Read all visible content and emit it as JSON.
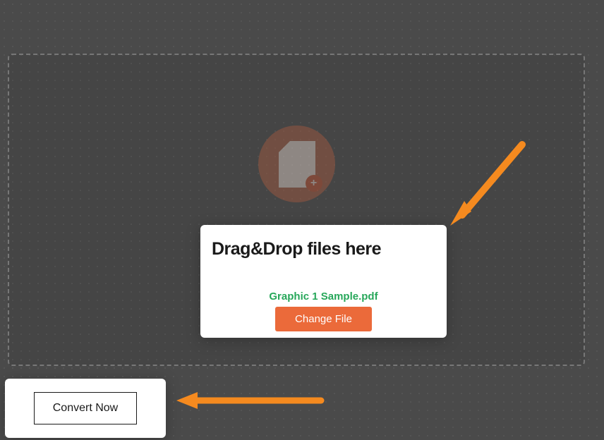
{
  "dropzone": {
    "title": "Drag&Drop files here",
    "filename": "Graphic 1 Sample.pdf",
    "change_button": "Change File"
  },
  "convert": {
    "button": "Convert Now"
  },
  "icons": {
    "file_plus": "+"
  }
}
